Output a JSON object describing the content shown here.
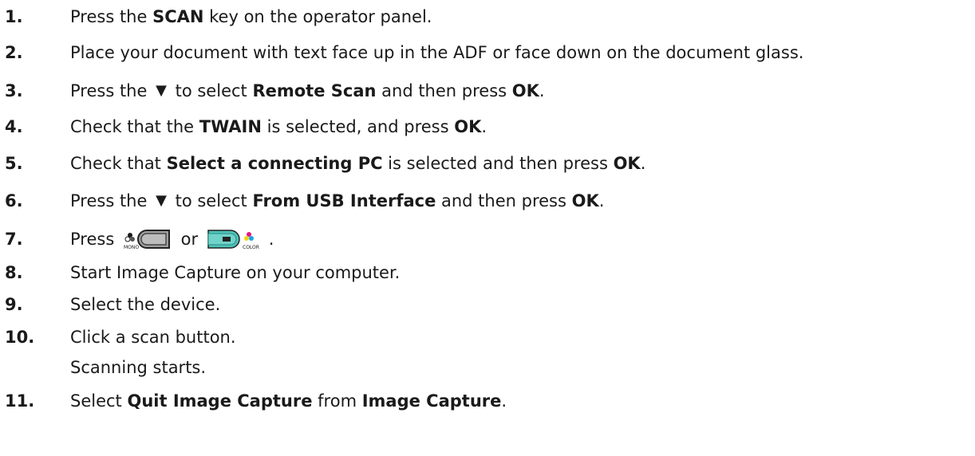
{
  "steps": [
    {
      "num": "1.",
      "parts": [
        [
          "Press the "
        ],
        [
          "SCAN",
          "b"
        ],
        [
          " key on the operator panel."
        ]
      ]
    },
    {
      "num": "2.",
      "parts": [
        [
          "Place your document with text face up in the ADF or face down on the document glass."
        ]
      ]
    },
    {
      "num": "3.",
      "parts": [
        [
          "Press the "
        ],
        [
          "▼",
          "arrow"
        ],
        [
          " to select "
        ],
        [
          "Remote Scan",
          "b"
        ],
        [
          " and then press "
        ],
        [
          "OK",
          "b"
        ],
        [
          "."
        ]
      ]
    },
    {
      "num": "4.",
      "parts": [
        [
          "Check that the "
        ],
        [
          "TWAIN",
          "b"
        ],
        [
          " is selected, and press "
        ],
        [
          "OK",
          "b"
        ],
        [
          "."
        ]
      ]
    },
    {
      "num": "5.",
      "parts": [
        [
          "Check that "
        ],
        [
          "Select a connecting PC",
          "b"
        ],
        [
          " is selected and then press "
        ],
        [
          "OK",
          "b"
        ],
        [
          "."
        ]
      ]
    },
    {
      "num": "6.",
      "parts": [
        [
          "Press the "
        ],
        [
          "▼",
          "arrow"
        ],
        [
          " to select "
        ],
        [
          "From USB Interface",
          "b"
        ],
        [
          " and then press "
        ],
        [
          "OK",
          "b"
        ],
        [
          "."
        ]
      ]
    },
    {
      "num": "7.",
      "parts": [
        [
          "Press "
        ],
        [
          "mono-key-icon",
          "icon"
        ],
        [
          " or "
        ],
        [
          "color-key-icon",
          "icon"
        ],
        [
          "."
        ]
      ]
    },
    {
      "num": "8.",
      "parts": [
        [
          "Start Image Capture on your computer."
        ]
      ]
    },
    {
      "num": "9.",
      "parts": [
        [
          "Select the device."
        ]
      ]
    },
    {
      "num": "10.",
      "parts": [
        [
          "Click a scan button."
        ]
      ]
    },
    {
      "num": "",
      "parts": [
        [
          "Scanning starts."
        ]
      ]
    },
    {
      "num": "11.",
      "parts": [
        [
          "Select "
        ],
        [
          "Quit Image Capture",
          "b"
        ],
        [
          " from "
        ],
        [
          "Image Capture",
          "b"
        ],
        [
          "."
        ]
      ]
    }
  ],
  "icons": {
    "mono_label": "MONO",
    "color_label": "COLOR",
    "mono_key_color": "#9e9e9e",
    "color_key_color": "#4ec3b8"
  }
}
